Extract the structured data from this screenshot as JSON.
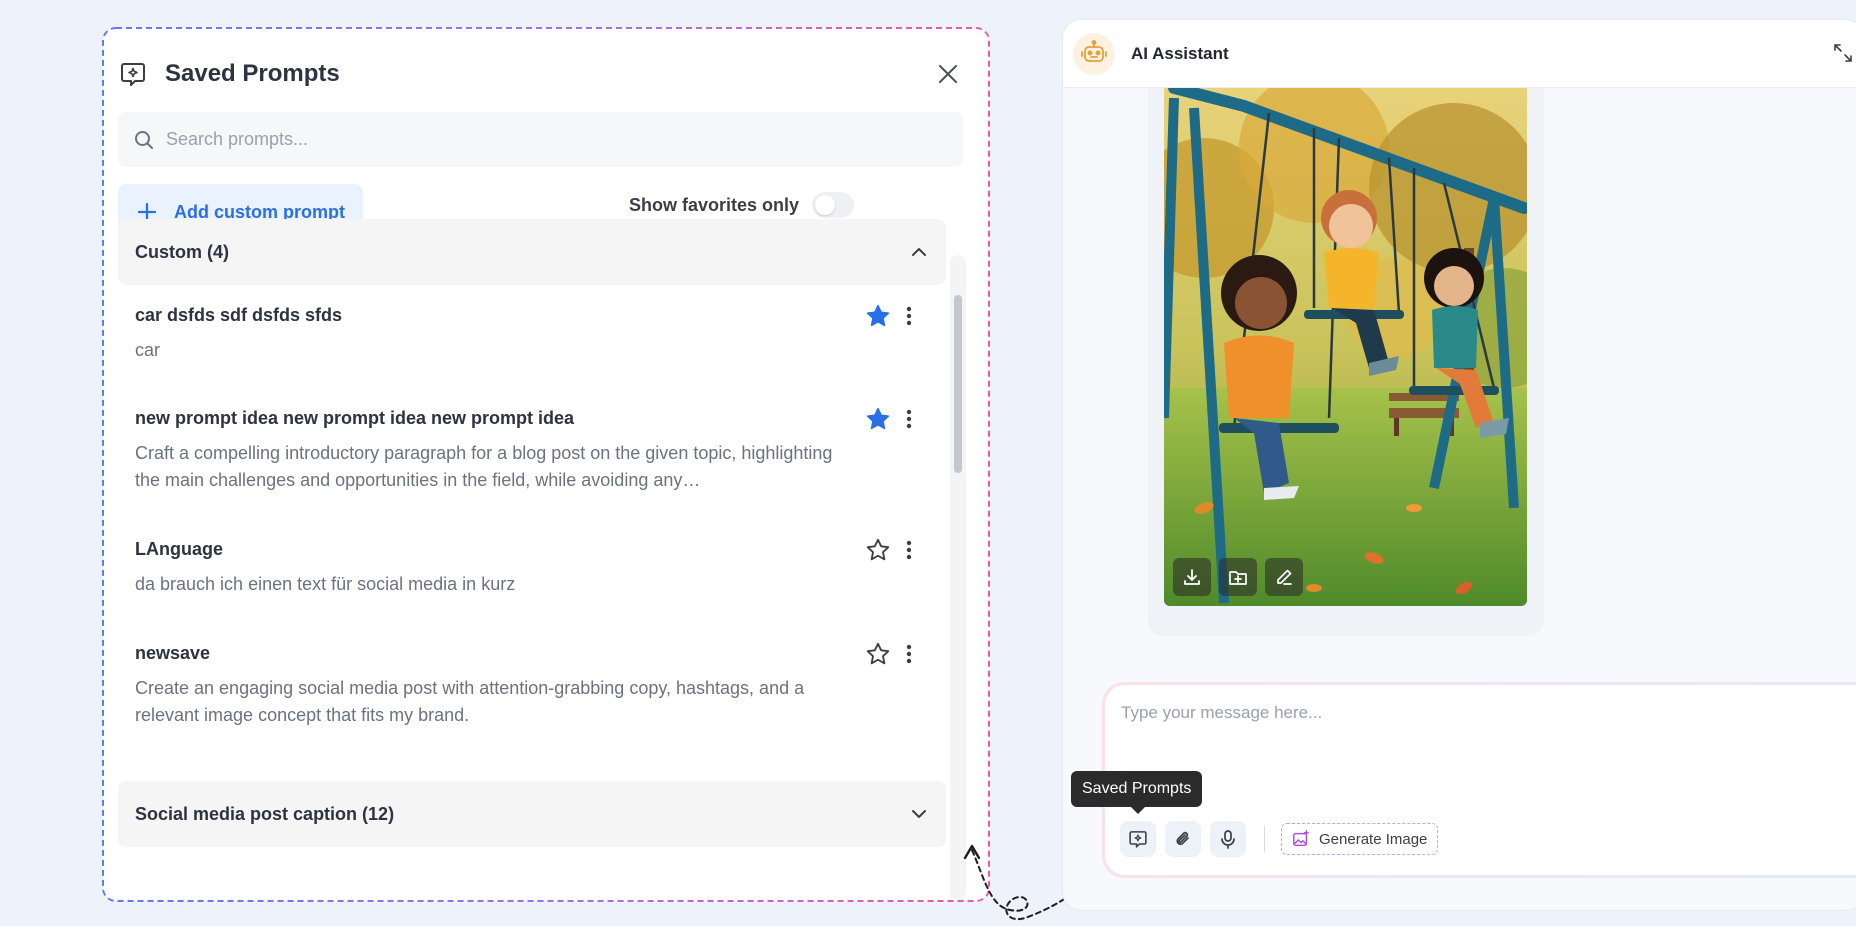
{
  "saved_prompts": {
    "title": "Saved Prompts",
    "search_placeholder": "Search prompts...",
    "add_label": "Add custom prompt",
    "favorites_label": "Show favorites only",
    "favorites_only": false,
    "groups": [
      {
        "title": "Custom (4)",
        "expanded": true,
        "items": [
          {
            "title": "car dsfds sdf dsfds sfds",
            "desc": "car",
            "favorite": true
          },
          {
            "title": "new prompt idea new prompt idea new prompt idea",
            "desc": "Craft a compelling introductory paragraph for a blog post on the given topic, highlighting the main challenges and opportunities in the field, while avoiding any…",
            "favorite": true
          },
          {
            "title": "LAnguage",
            "desc": "da brauch ich einen text für social media in kurz",
            "favorite": false
          },
          {
            "title": "newsave",
            "desc": "Create an engaging social media post with attention-grabbing copy, hashtags, and a relevant image concept that fits my brand.",
            "favorite": false
          }
        ]
      },
      {
        "title": "Social media post caption (12)",
        "expanded": false
      }
    ]
  },
  "assistant": {
    "title": "AI Assistant",
    "input_placeholder": "Type your message here...",
    "tooltip": "Saved Prompts",
    "generate_label": "Generate Image",
    "image_tools": [
      "download-icon",
      "save-to-folder-icon",
      "edit-icon"
    ]
  },
  "colors": {
    "accent_blue": "#2a6fe8",
    "star_filled": "#2a6fe8",
    "frame_gradient_start": "#5b7cf2",
    "frame_gradient_end": "#ec5aa9"
  }
}
